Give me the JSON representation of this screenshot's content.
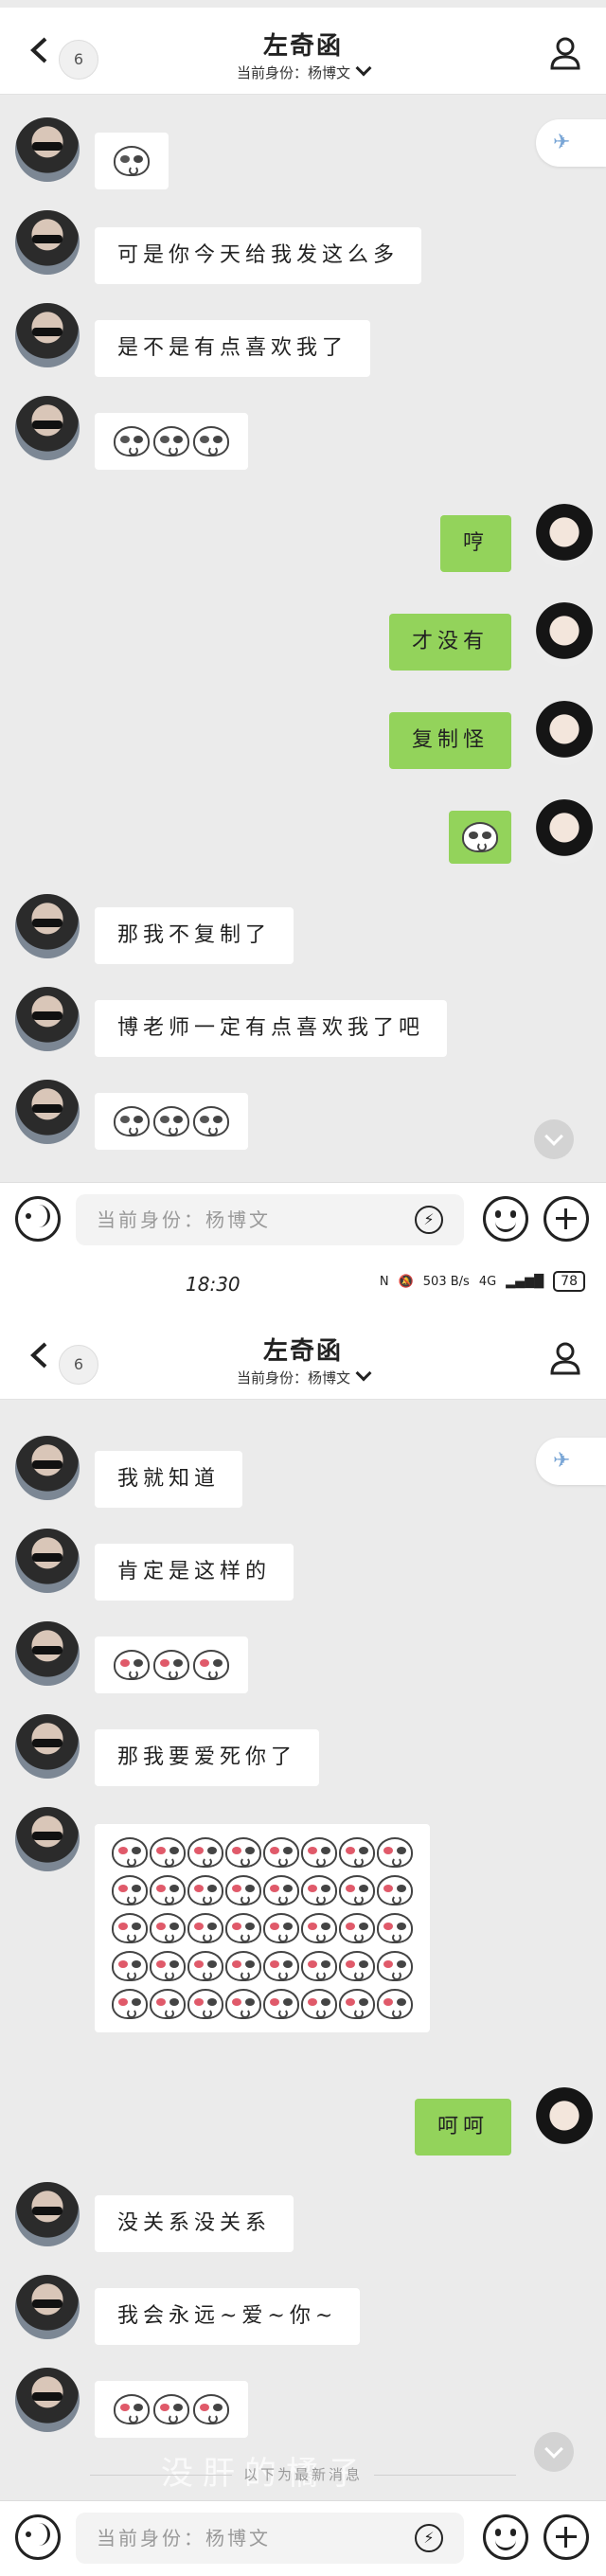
{
  "chat": {
    "contact_name": "左奇函",
    "identity_label": "当前身份：杨博文",
    "unread_count": "6",
    "input_placeholder": "当前身份：杨博文"
  },
  "status_bar": {
    "time": "18:30",
    "network_speed": "503 B/s",
    "signal": "4G",
    "battery": "78"
  },
  "screen1": {
    "messages": [
      {
        "from": "other",
        "type": "sticker",
        "sticker": "glasses-cry-sticker"
      },
      {
        "from": "other",
        "type": "text",
        "text": "可是你今天给我发这么多"
      },
      {
        "from": "other",
        "type": "text",
        "text": "是不是有点喜欢我了"
      },
      {
        "from": "other",
        "type": "sticker",
        "sticker": "sunglasses-stickers-x3"
      },
      {
        "from": "me",
        "type": "text",
        "text": "哼"
      },
      {
        "from": "me",
        "type": "text",
        "text": "才没有"
      },
      {
        "from": "me",
        "type": "text",
        "text": "复制怪"
      },
      {
        "from": "me",
        "type": "sticker",
        "sticker": "sleepy-sticker"
      },
      {
        "from": "other",
        "type": "text",
        "text": "那我不复制了"
      },
      {
        "from": "other",
        "type": "text",
        "text": "博老师一定有点喜欢我了吧"
      },
      {
        "from": "other",
        "type": "sticker",
        "sticker": "glasses-stickers-x3"
      }
    ]
  },
  "screen2": {
    "messages": [
      {
        "from": "other",
        "type": "text",
        "text": "我就知道"
      },
      {
        "from": "other",
        "type": "text",
        "text": "肯定是这样的"
      },
      {
        "from": "other",
        "type": "sticker",
        "sticker": "heart-eyes-stickers-x3"
      },
      {
        "from": "other",
        "type": "text",
        "text": "那我要爱死你了"
      },
      {
        "from": "other",
        "type": "sticker",
        "sticker": "heart-eyes-stickers-x40"
      },
      {
        "from": "me",
        "type": "text",
        "text": "呵呵"
      },
      {
        "from": "other",
        "type": "text",
        "text": "没关系没关系"
      },
      {
        "from": "other",
        "type": "text",
        "text": "我会永远~爱~你~"
      },
      {
        "from": "other",
        "type": "sticker",
        "sticker": "heart-eyes-stickers-x3"
      }
    ],
    "new_messages_divider": "以下为最新消息",
    "watermark": "没肝的橘子"
  },
  "colors": {
    "my_bubble": "#93d35b",
    "their_bubble": "#ffffff",
    "background": "#ebebeb"
  }
}
